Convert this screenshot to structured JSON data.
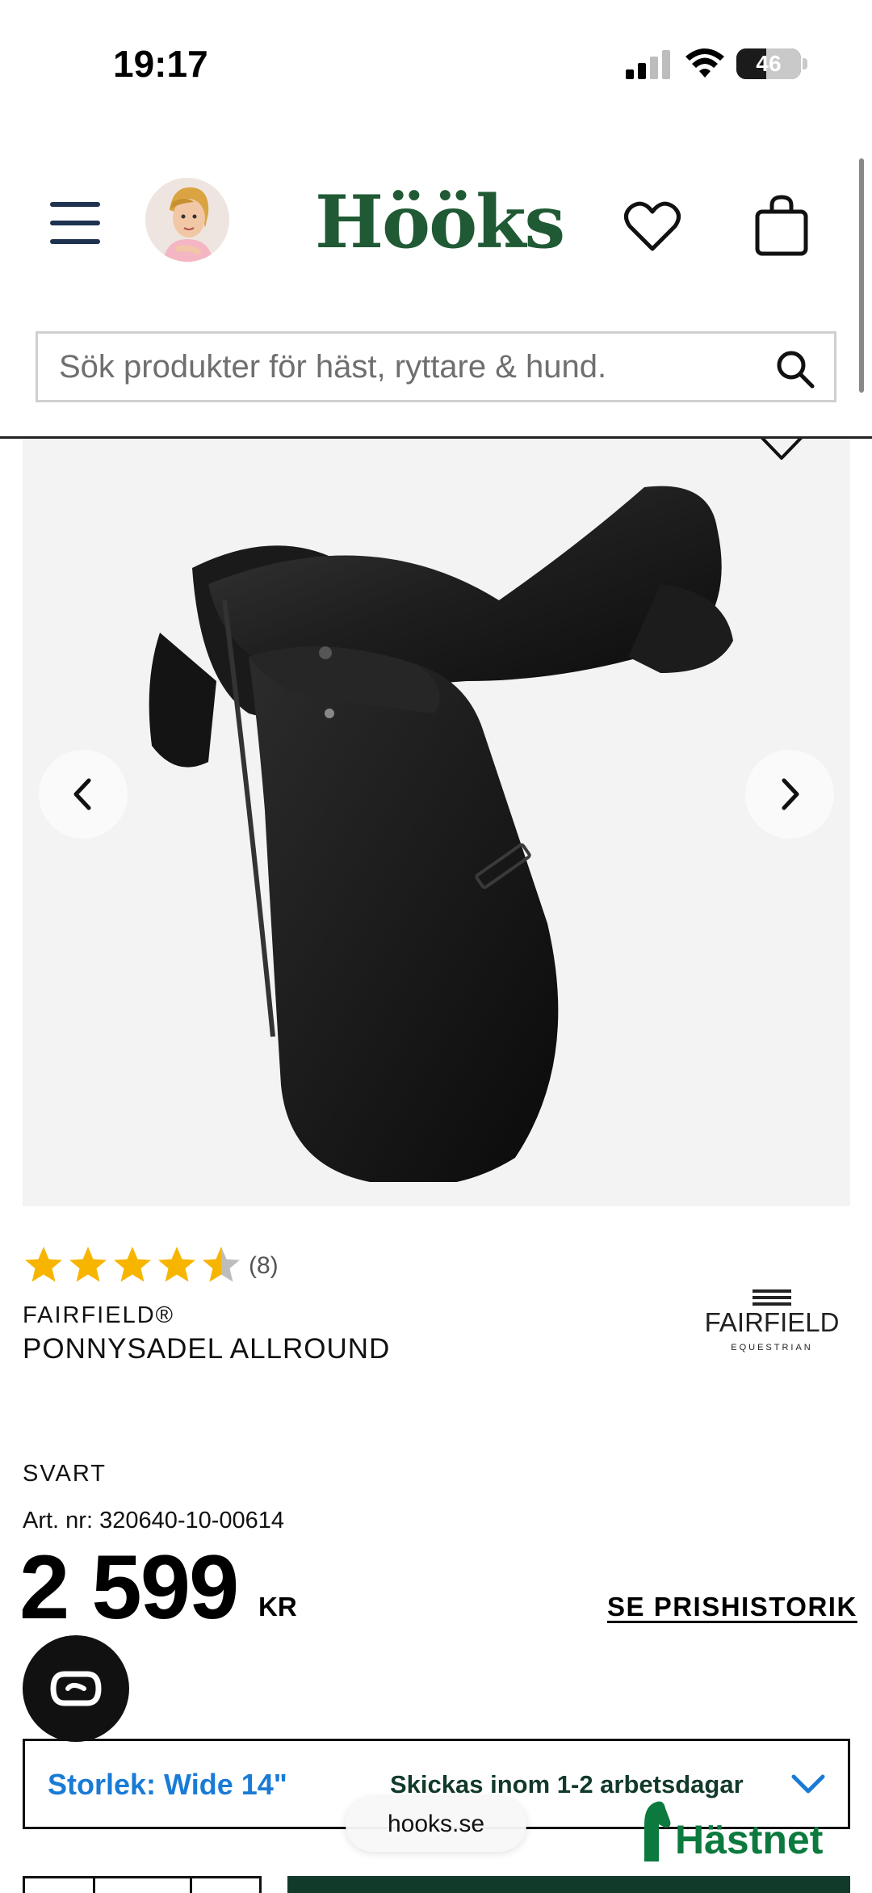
{
  "status": {
    "time": "19:17",
    "battery": "46",
    "battery_level": 0.46
  },
  "header": {
    "logo": "Hööks"
  },
  "search": {
    "placeholder": "Sök produkter för häst, ryttare & hund."
  },
  "product": {
    "rating_value": 4.5,
    "rating_max": 5,
    "rating_count": "(8)",
    "brand": "FAIRFIELD®",
    "title": "PONNYSADEL ALLROUND",
    "brand_logo_text": "FAIRFIELD",
    "brand_logo_sub": "EQUESTRIAN",
    "color": "SVART",
    "article_number": "Art. nr: 320640-10-00614",
    "price": "2 599",
    "currency": "KR",
    "price_history_link": "SE PRISHISTORIK"
  },
  "size_selector": {
    "selected": "Storlek: Wide 14\"",
    "shipping": "Skickas inom 1-2 arbetsdagar"
  },
  "browser": {
    "url": "hooks.se"
  },
  "badge": {
    "text": "Hästnet"
  },
  "colors": {
    "brand_green": "#1f5a34",
    "link_blue": "#1a7bd6",
    "star_yellow": "#f7b500",
    "dark_green": "#123a2a"
  }
}
